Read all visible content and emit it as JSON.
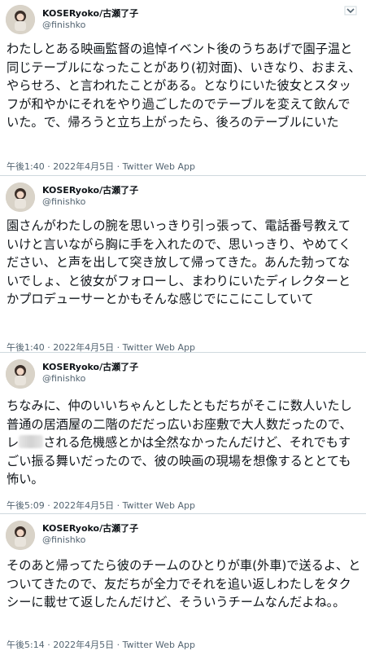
{
  "author": {
    "name": "KOSERyoko/古瀬了子",
    "handle": "@finishko"
  },
  "tweets": [
    {
      "text": "わたしとある映画監督の追悼イベント後のうちあげで園子温と同じテーブルになったことがあり(初対面)、いきなり、おまえ、やらせろ、と言われたことがある。となりにいた彼女とスタッフが和やかにそれをやり過ごしたのでテーブルを変えて飲んでいた。で、帰ろうと立ち上がったら、後ろのテーブルにいた",
      "meta": "午後1:40 · 2022年4月5日 · Twitter Web App"
    },
    {
      "text": "園さんがわたしの腕を思いっきり引っ張って、電話番号教えていけと言いながら胸に手を入れたので、思いっきり、やめてください、と声を出して突き放して帰ってきた。あんた勃ってないでしょ、と彼女がフォローし、まわりにいたディレクターとかプロデューサーとかもそんな感じでにこにこしていて",
      "meta": "午後1:40 · 2022年4月5日 · Twitter Web App"
    },
    {
      "text_before": "ちなみに、仲のいいちゃんとしたともだちがそこに数人いたし普通の居酒屋の二階のだだっ広いお座敷で大人数だったので、レ",
      "text_after": "される危機感とかは全然なかったんだけど、それでもすごい振る舞いだったので、彼の映画の現場を想像するととても怖い。",
      "meta": "午後5:09 · 2022年4月5日 · Twitter Web App"
    },
    {
      "text": "そのあと帰ってたら彼のチームのひとりが車(外車)で送るよ、とついてきたので、友だちが全力でそれを追い返しわたしをタクシーに載せて返したんだけど、そういうチームなんだよね。。",
      "meta": "午後5:14 · 2022年4月5日 · Twitter Web App"
    }
  ],
  "icons": {
    "avatar": "avatar-photo",
    "more": "chevron-down-icon"
  }
}
